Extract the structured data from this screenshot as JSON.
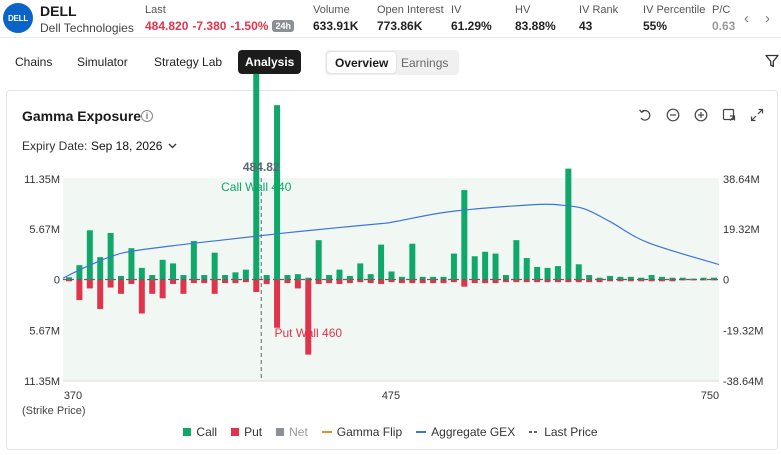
{
  "header": {
    "logo": "DELL",
    "symbol": "DELL",
    "company": "Dell Technologies",
    "stats": [
      {
        "label": "Last",
        "value": "484.820",
        "change": "-7.380",
        "pct": "-1.50%",
        "badge": "24h"
      },
      {
        "label": "Volume",
        "value": "633.91K"
      },
      {
        "label": "Open Interest",
        "value": "773.86K"
      },
      {
        "label": "IV",
        "value": "61.29%"
      },
      {
        "label": "HV",
        "value": "83.88%"
      },
      {
        "label": "IV Rank",
        "value": "43"
      },
      {
        "label": "IV Percentile",
        "value": "55%"
      },
      {
        "label": "P/C",
        "value": "0.63"
      }
    ],
    "prev_arrow": "‹",
    "next_arrow": "›"
  },
  "tabs": {
    "items": [
      "Chains",
      "Simulator",
      "Strategy Lab",
      "Analysis"
    ],
    "active": "Analysis",
    "segment": [
      "Overview",
      "Earnings"
    ],
    "segment_active": "Overview"
  },
  "card": {
    "title": "Gamma Exposure",
    "info_icon": "i",
    "expiry_label": "Expiry Date:",
    "expiry_value": "Sep 18, 2026",
    "toolbar_icons": [
      "reset-icon",
      "zoom-out-icon",
      "zoom-in-icon",
      "export-icon",
      "fullscreen-icon"
    ]
  },
  "colors": {
    "call": "#10a86a",
    "put": "#e0344d",
    "net": "#8b8f96",
    "gamma_flip": "#f08a24",
    "aggregate": "#3d74d9",
    "last_price": "#5a6470"
  },
  "chart_data": {
    "type": "bar",
    "xlabel": "(Strike Price)",
    "x_ticks": [
      "370",
      "475",
      "750"
    ],
    "y_left_ticks": [
      "11.35M",
      "5.67M",
      "0",
      "5.67M",
      "11.35M"
    ],
    "y_right_ticks": [
      "38.64M",
      "19.32M",
      "0",
      "-19.32M",
      "-38.64M"
    ],
    "ylim_left": [
      -11.35,
      11.35
    ],
    "ylim_right": [
      -38.64,
      38.64
    ],
    "last_price": "484.82",
    "annotations": {
      "call_wall": "Call Wall 440",
      "put_wall": "Put Wall 460"
    },
    "series": [
      {
        "name": "Call",
        "values": [
          0.25,
          1.6,
          5.5,
          2.5,
          5.2,
          0.4,
          3.5,
          1.3,
          0.5,
          2.2,
          1.8,
          0.5,
          4.3,
          0.5,
          3.0,
          0.5,
          0.8,
          1.1,
          23.0,
          0.5,
          19.5,
          0.5,
          0.6,
          0.2,
          4.4,
          0.5,
          1.1,
          0.4,
          1.8,
          0.6,
          3.9,
          0.9,
          0.3,
          4.0,
          0.3,
          0.3,
          0.3,
          2.9,
          10.0,
          2.6,
          3.1,
          2.9,
          0.5,
          4.4,
          2.4,
          1.4,
          1.3,
          1.5,
          12.4,
          1.7,
          0.5,
          0.2,
          0.4,
          0.3,
          0.3,
          0.2,
          0.5,
          0.3,
          0.2,
          0.2,
          0.1,
          0.2,
          0.2
        ]
      },
      {
        "name": "Put",
        "values": [
          -0.2,
          -2.3,
          -1.0,
          -3.3,
          -0.9,
          -1.6,
          -0.5,
          -3.8,
          -1.6,
          -2.1,
          -0.5,
          -1.6,
          -0.4,
          -0.4,
          -1.6,
          -0.4,
          -0.4,
          -0.3,
          -1.4,
          -0.5,
          -5.4,
          -0.4,
          -1.0,
          -8.4,
          -0.5,
          -0.4,
          -0.5,
          -0.4,
          -0.3,
          -0.4,
          -0.5,
          -0.3,
          -0.4,
          -0.4,
          -0.4,
          -0.4,
          -0.4,
          -0.3,
          -0.8,
          -0.4,
          -0.4,
          -0.4,
          -0.3,
          -0.3,
          -0.3,
          -0.3,
          -0.3,
          -0.3,
          -0.3,
          -0.3,
          -0.3,
          -0.3,
          -0.2,
          -0.2,
          -0.2,
          -0.2,
          -0.2,
          -0.2,
          -0.2,
          -0.1,
          -0.1,
          -0.1,
          -0.1
        ]
      },
      {
        "name": "Aggregate GEX",
        "x": [
          370,
          384,
          404,
          433,
          466,
          500,
          532,
          556,
          563,
          595,
          643,
          659,
          672,
          687,
          709,
          750
        ],
        "values": [
          0.5,
          5.0,
          10.0,
          12.8,
          15.3,
          17.8,
          19.9,
          21.4,
          22.1,
          25.9,
          28.5,
          28.3,
          26.9,
          22.0,
          14.0,
          5.7
        ]
      },
      {
        "name": "Net"
      },
      {
        "name": "Gamma Flip"
      },
      {
        "name": "Last Price"
      }
    ]
  },
  "legend": [
    "Call",
    "Put",
    "Net",
    "Gamma Flip",
    "Aggregate GEX",
    "Last Price"
  ]
}
